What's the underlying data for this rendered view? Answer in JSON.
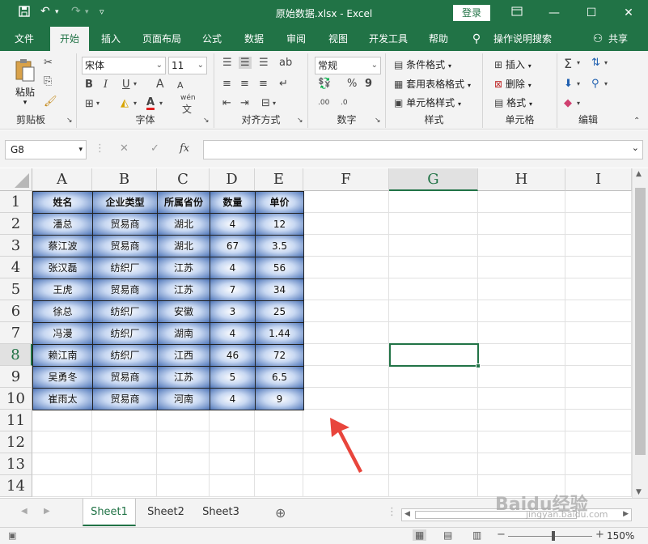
{
  "title": "原始数据.xlsx  -  Excel",
  "login_label": "登录",
  "tabs": [
    {
      "label": "文件"
    },
    {
      "label": "开始",
      "active": true
    },
    {
      "label": "插入"
    },
    {
      "label": "页面布局"
    },
    {
      "label": "公式"
    },
    {
      "label": "数据"
    },
    {
      "label": "审阅"
    },
    {
      "label": "视图"
    },
    {
      "label": "开发工具"
    },
    {
      "label": "帮助"
    },
    {
      "label": "操作说明搜索"
    }
  ],
  "share_label": "共享",
  "ribbon": {
    "clipboard": {
      "paste": "粘贴",
      "group": "剪贴板"
    },
    "font": {
      "name": "宋体",
      "size": "11",
      "group": "字体",
      "bold": "B",
      "italic": "I",
      "underline": "U",
      "grow": "A",
      "shrink": "A",
      "color_letter": "A",
      "wen": "wén",
      "wen_char": "文"
    },
    "alignment": {
      "group": "对齐方式"
    },
    "number": {
      "format": "常规",
      "percent": "%",
      "comma": "9",
      "group": "数字",
      "inc_decimal": ".00",
      "dec_decimal": ".0"
    },
    "styles": {
      "cond": "条件格式",
      "table": "套用表格格式",
      "cell": "单元格样式",
      "group": "样式"
    },
    "cells": {
      "insert": "插入",
      "delete": "删除",
      "format": "格式",
      "group": "单元格"
    },
    "editing": {
      "group": "编辑"
    }
  },
  "formula_bar": {
    "name_box": "G8",
    "fx": "fx",
    "value": ""
  },
  "columns": [
    "A",
    "B",
    "C",
    "D",
    "E",
    "F",
    "G",
    "H",
    "I"
  ],
  "selected_column": "G",
  "rows": [
    "1",
    "2",
    "3",
    "4",
    "5",
    "6",
    "7",
    "8",
    "9",
    "10",
    "11",
    "12",
    "13",
    "14"
  ],
  "selected_row": "8",
  "table": {
    "headers": [
      "姓名",
      "企业类型",
      "所属省份",
      "数量",
      "单价"
    ],
    "rows": [
      [
        "潘总",
        "贸易商",
        "湖北",
        "4",
        "12"
      ],
      [
        "蔡江波",
        "贸易商",
        "湖北",
        "67",
        "3.5"
      ],
      [
        "张汉磊",
        "纺织厂",
        "江苏",
        "4",
        "56"
      ],
      [
        "王虎",
        "贸易商",
        "江苏",
        "7",
        "34"
      ],
      [
        "徐总",
        "纺织厂",
        "安徽",
        "3",
        "25"
      ],
      [
        "冯漫",
        "纺织厂",
        "湖南",
        "4",
        "1.44"
      ],
      [
        "赖江南",
        "纺织厂",
        "江西",
        "46",
        "72"
      ],
      [
        "吴勇冬",
        "贸易商",
        "江苏",
        "5",
        "6.5"
      ],
      [
        "崔雨太",
        "贸易商",
        "河南",
        "4",
        "9"
      ]
    ]
  },
  "sheets": [
    {
      "label": "Sheet1",
      "active": true
    },
    {
      "label": "Sheet2"
    },
    {
      "label": "Sheet3"
    }
  ],
  "zoom": "150%",
  "watermark": {
    "main": "Baidu经验",
    "sub": "jingyan.baidu.com"
  },
  "colors": {
    "accent": "#217346",
    "arrow": "#e8453c"
  }
}
